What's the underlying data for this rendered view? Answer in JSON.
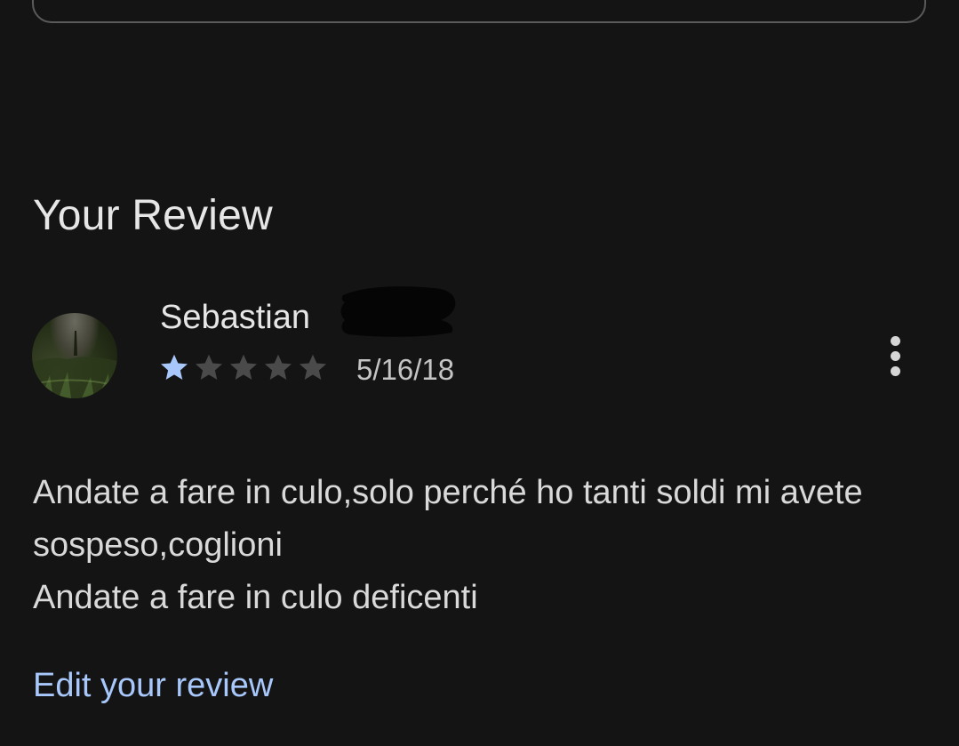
{
  "section": {
    "title": "Your Review"
  },
  "review": {
    "author": "Sebastian",
    "rating": 1,
    "max_rating": 5,
    "date": "5/16/18",
    "text": "Andate a fare in culo,solo perché ho tanti soldi mi avete sospeso,coglioni\nAndate a fare in culo deficenti",
    "more_icon": "more-vert-icon"
  },
  "actions": {
    "edit_label": "Edit your review"
  },
  "colors": {
    "background": "#141414",
    "star_filled": "#a8c7fa",
    "star_empty": "#4a4a4a",
    "link": "#a8c7fa"
  }
}
